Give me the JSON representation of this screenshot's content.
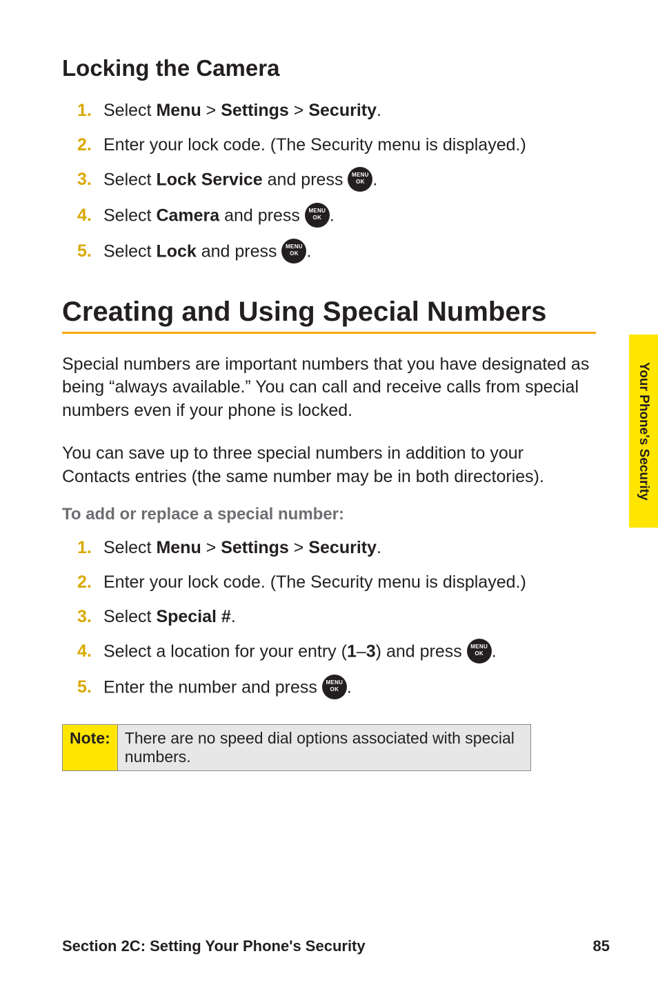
{
  "side_tab": "Your Phone's Security",
  "sub_heading": "Locking the Camera",
  "steps_a": [
    {
      "num": "1.",
      "pre": "Select ",
      "bold1": "Menu",
      "mid1": " > ",
      "bold2": "Settings",
      "mid2": " > ",
      "bold3": "Security",
      "post": "."
    },
    {
      "num": "2.",
      "plain": "Enter your lock code. (The Security menu is displayed.)"
    },
    {
      "num": "3.",
      "pre": "Select ",
      "bold1": "Lock Service",
      "mid1": " and press ",
      "has_btn": true,
      "post": "."
    },
    {
      "num": "4.",
      "pre": "Select ",
      "bold1": "Camera",
      "mid1": " and press ",
      "has_btn": true,
      "post": "."
    },
    {
      "num": "5.",
      "pre": "Select ",
      "bold1": "Lock",
      "mid1": " and press ",
      "has_btn": true,
      "post": "."
    }
  ],
  "main_heading": "Creating and Using Special Numbers",
  "para1": "Special numbers are important numbers that you have designated as being “always available.” You can call and receive calls from special numbers even if your phone is locked.",
  "para2": "You can save up to three special numbers in addition to your Contacts entries (the same number may be in both directories).",
  "lead": "To add or replace a special number:",
  "steps_b": [
    {
      "num": "1.",
      "pre": "Select ",
      "bold1": "Menu",
      "mid1": " > ",
      "bold2": "Settings",
      "mid2": " > ",
      "bold3": "Security",
      "post": "."
    },
    {
      "num": "2.",
      "plain": "Enter your lock code. (The Security menu is displayed.)"
    },
    {
      "num": "3.",
      "pre": "Select ",
      "bold1": "Special #",
      "post": "."
    },
    {
      "num": "4.",
      "pre": "Select a location for your entry (",
      "bold1": "1",
      "mid1": "–",
      "bold2": "3",
      "mid2": ") and press ",
      "has_btn": true,
      "post": "."
    },
    {
      "num": "5.",
      "pre": "Enter the number and press ",
      "has_btn": true,
      "post": "."
    }
  ],
  "note_label": "Note:",
  "note_text": "There are no speed dial options associated with special numbers.",
  "footer_left": "Section 2C: Setting Your Phone's Security",
  "footer_right": "85"
}
